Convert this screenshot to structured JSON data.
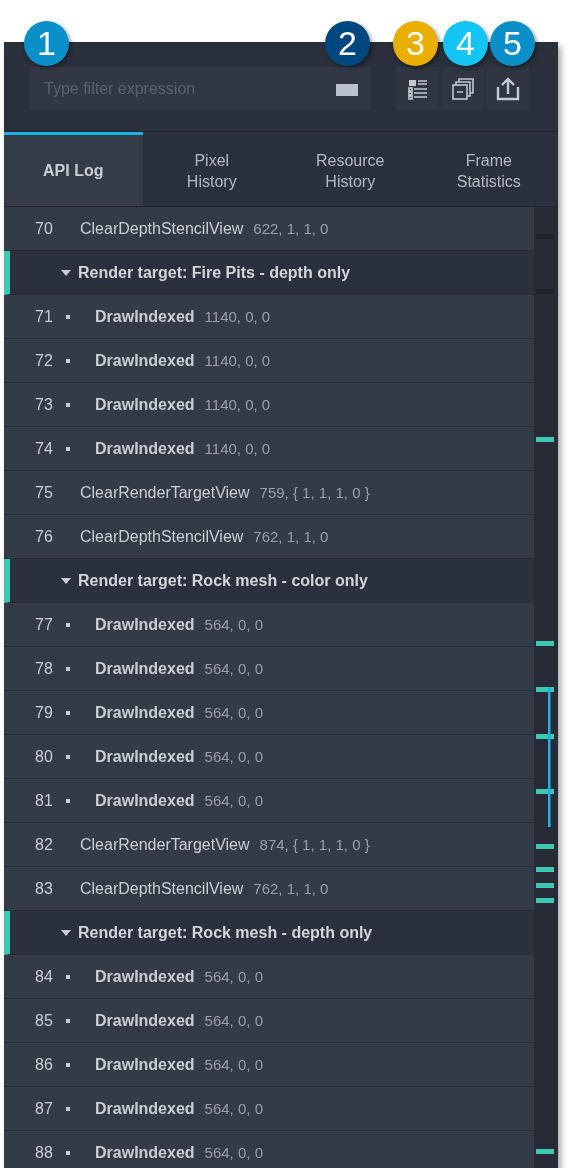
{
  "callouts": [
    {
      "label": "1",
      "color": "#0b8fc9"
    },
    {
      "label": "2",
      "color": "#00477f"
    },
    {
      "label": "3",
      "color": "#e9ae00"
    },
    {
      "label": "4",
      "color": "#14c4f5"
    },
    {
      "label": "5",
      "color": "#0b8fc9"
    }
  ],
  "filter": {
    "placeholder": "Type filter expression"
  },
  "tabs": [
    {
      "label": "API Log",
      "selected": true
    },
    {
      "label": "Pixel History",
      "selected": false
    },
    {
      "label": "Resource History",
      "selected": false
    },
    {
      "label": "Frame Statistics",
      "selected": false
    }
  ],
  "rows": [
    {
      "kind": "call",
      "number": "70",
      "name": "ClearDepthStencilView",
      "args": "622, 1, 1, 0"
    },
    {
      "kind": "group",
      "label": "Render target: Fire Pits - depth only",
      "expanded": true,
      "children": [
        {
          "kind": "call",
          "number": "71",
          "name": "DrawIndexed",
          "args": "1140, 0, 0"
        },
        {
          "kind": "call",
          "number": "72",
          "name": "DrawIndexed",
          "args": "1140, 0, 0"
        },
        {
          "kind": "call",
          "number": "73",
          "name": "DrawIndexed",
          "args": "1140, 0, 0"
        },
        {
          "kind": "call",
          "number": "74",
          "name": "DrawIndexed",
          "args": "1140, 0, 0"
        }
      ]
    },
    {
      "kind": "call",
      "number": "75",
      "name": "ClearRenderTargetView",
      "args": "759, { 1, 1, 1, 0 }"
    },
    {
      "kind": "call",
      "number": "76",
      "name": "ClearDepthStencilView",
      "args": "762, 1, 1, 0"
    },
    {
      "kind": "group",
      "label": "Render target: Rock mesh - color only",
      "expanded": true,
      "children": [
        {
          "kind": "call",
          "number": "77",
          "name": "DrawIndexed",
          "args": "564, 0, 0"
        },
        {
          "kind": "call",
          "number": "78",
          "name": "DrawIndexed",
          "args": "564, 0, 0"
        },
        {
          "kind": "call",
          "number": "79",
          "name": "DrawIndexed",
          "args": "564, 0, 0"
        },
        {
          "kind": "call",
          "number": "80",
          "name": "DrawIndexed",
          "args": "564, 0, 0"
        },
        {
          "kind": "call",
          "number": "81",
          "name": "DrawIndexed",
          "args": "564, 0, 0"
        }
      ]
    },
    {
      "kind": "call",
      "number": "82",
      "name": "ClearRenderTargetView",
      "args": "874, { 1, 1, 1, 0 }"
    },
    {
      "kind": "call",
      "number": "83",
      "name": "ClearDepthStencilView",
      "args": "762, 1, 1, 0"
    },
    {
      "kind": "group",
      "label": "Render target: Rock mesh - depth only",
      "expanded": true,
      "children": [
        {
          "kind": "call",
          "number": "84",
          "name": "DrawIndexed",
          "args": "564, 0, 0"
        },
        {
          "kind": "call",
          "number": "85",
          "name": "DrawIndexed",
          "args": "564, 0, 0"
        },
        {
          "kind": "call",
          "number": "86",
          "name": "DrawIndexed",
          "args": "564, 0, 0"
        },
        {
          "kind": "call",
          "number": "87",
          "name": "DrawIndexed",
          "args": "564, 0, 0"
        },
        {
          "kind": "call",
          "number": "88",
          "name": "DrawIndexed",
          "args": "564, 0, 0"
        }
      ]
    }
  ]
}
